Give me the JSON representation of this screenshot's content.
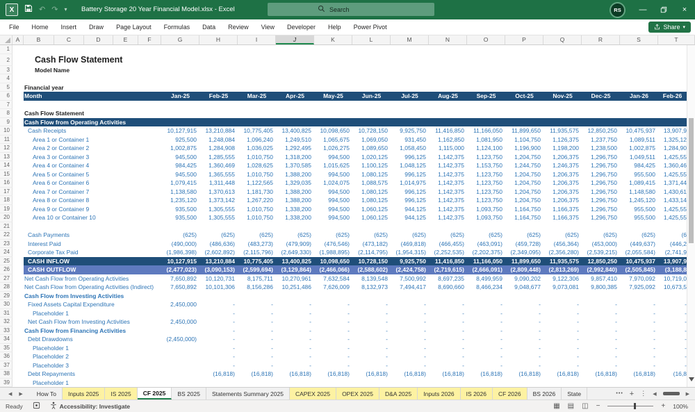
{
  "titlebar": {
    "title": "Battery Storage 20 Year Financial Model.xlsx - Excel",
    "search_placeholder": "Search",
    "avatar_initials": "RS"
  },
  "menubar": {
    "tabs": [
      "File",
      "Home",
      "Insert",
      "Draw",
      "Page Layout",
      "Formulas",
      "Data",
      "Review",
      "View",
      "Developer",
      "Help",
      "Power Pivot"
    ],
    "share_label": "Share"
  },
  "columns": {
    "letters": [
      "A",
      "B",
      "C",
      "D",
      "E",
      "F",
      "G",
      "H",
      "I",
      "J",
      "K",
      "L",
      "M",
      "N",
      "O",
      "P",
      "Q",
      "R",
      "S",
      "T"
    ],
    "selected": "J"
  },
  "sheet": {
    "months": [
      "Jan-25",
      "Feb-25",
      "Mar-25",
      "Apr-25",
      "May-25",
      "Jun-25",
      "Jul-25",
      "Aug-25",
      "Sep-25",
      "Oct-25",
      "Nov-25",
      "Dec-25",
      "Jan-26",
      "Feb-26"
    ],
    "rows": [
      {
        "n": 1,
        "t": "blank"
      },
      {
        "n": 2,
        "t": "title",
        "ind": 3,
        "label": "Cash Flow Statement"
      },
      {
        "n": 3,
        "t": "bold",
        "ind": 3,
        "label": "Model Name"
      },
      {
        "n": 4,
        "t": "blank"
      },
      {
        "n": 5,
        "t": "bold",
        "ind": 0,
        "label": "Financial year"
      },
      {
        "n": 6,
        "t": "months",
        "ind": 0,
        "label": "Month"
      },
      {
        "n": 7,
        "t": "blank"
      },
      {
        "n": 8,
        "t": "bold",
        "ind": 0,
        "label": "Cash Flow Statement"
      },
      {
        "n": 9,
        "t": "banner",
        "ind": 0,
        "label": "Cash Flow from Operating Activities"
      },
      {
        "n": 10,
        "t": "item",
        "ind": 1,
        "label": "Cash Receipts",
        "v": [
          "10,127,915",
          "13,210,884",
          "10,775,405",
          "13,400,825",
          "10,098,650",
          "10,728,150",
          "9,925,750",
          "11,416,850",
          "11,166,050",
          "11,899,650",
          "11,935,575",
          "12,850,250",
          "10,475,937",
          "13,907,9"
        ]
      },
      {
        "n": 11,
        "t": "item",
        "ind": 2,
        "label": "Area 1 or Container 1",
        "v": [
          "925,500",
          "1,248,084",
          "1,096,240",
          "1,249,510",
          "1,065,675",
          "1,069,050",
          "931,450",
          "1,162,850",
          "1,081,950",
          "1,104,750",
          "1,126,375",
          "1,237,750",
          "1,089,511",
          "1,325,12"
        ]
      },
      {
        "n": 12,
        "t": "item",
        "ind": 2,
        "label": "Area 2 or Container 2",
        "v": [
          "1,002,875",
          "1,284,908",
          "1,036,025",
          "1,292,495",
          "1,026,275",
          "1,089,650",
          "1,058,450",
          "1,115,000",
          "1,124,100",
          "1,196,900",
          "1,198,200",
          "1,238,500",
          "1,002,875",
          "1,284,90"
        ]
      },
      {
        "n": 13,
        "t": "item",
        "ind": 2,
        "label": "Area 3 or Container 3",
        "v": [
          "945,500",
          "1,285,555",
          "1,010,750",
          "1,318,200",
          "994,500",
          "1,020,125",
          "996,125",
          "1,142,375",
          "1,123,750",
          "1,204,750",
          "1,206,375",
          "1,296,750",
          "1,049,511",
          "1,425,55"
        ]
      },
      {
        "n": 14,
        "t": "item",
        "ind": 2,
        "label": "Area 4 or Container 4",
        "v": [
          "984,425",
          "1,360,469",
          "1,028,625",
          "1,370,585",
          "1,015,625",
          "1,100,125",
          "1,048,125",
          "1,142,375",
          "1,153,750",
          "1,244,750",
          "1,246,375",
          "1,296,750",
          "984,425",
          "1,360,46"
        ]
      },
      {
        "n": 15,
        "t": "item",
        "ind": 2,
        "label": "Area 5 or Container 5",
        "v": [
          "945,500",
          "1,365,555",
          "1,010,750",
          "1,388,200",
          "994,500",
          "1,080,125",
          "996,125",
          "1,142,375",
          "1,123,750",
          "1,204,750",
          "1,206,375",
          "1,296,750",
          "955,500",
          "1,425,55"
        ]
      },
      {
        "n": 16,
        "t": "item",
        "ind": 2,
        "label": "Area 6 or Container 6",
        "v": [
          "1,079,415",
          "1,311,448",
          "1,122,565",
          "1,329,035",
          "1,024,075",
          "1,088,575",
          "1,014,975",
          "1,142,375",
          "1,123,750",
          "1,204,750",
          "1,206,375",
          "1,296,750",
          "1,089,415",
          "1,371,44"
        ]
      },
      {
        "n": 17,
        "t": "item",
        "ind": 2,
        "label": "Area 7 or Container 7",
        "v": [
          "1,138,580",
          "1,370,613",
          "1,181,730",
          "1,388,200",
          "994,500",
          "1,080,125",
          "996,125",
          "1,142,375",
          "1,123,750",
          "1,204,750",
          "1,206,375",
          "1,296,750",
          "1,148,580",
          "1,430,61"
        ]
      },
      {
        "n": 18,
        "t": "item",
        "ind": 2,
        "label": "Area 8 or Container 8",
        "v": [
          "1,235,120",
          "1,373,142",
          "1,267,220",
          "1,388,200",
          "994,500",
          "1,080,125",
          "996,125",
          "1,142,375",
          "1,123,750",
          "1,204,750",
          "1,206,375",
          "1,296,750",
          "1,245,120",
          "1,433,14"
        ]
      },
      {
        "n": 19,
        "t": "item",
        "ind": 2,
        "label": "Area 9 or Container 9",
        "v": [
          "935,500",
          "1,305,555",
          "1,010,750",
          "1,338,200",
          "994,500",
          "1,060,125",
          "944,125",
          "1,142,375",
          "1,093,750",
          "1,164,750",
          "1,166,375",
          "1,296,750",
          "955,500",
          "1,425,55"
        ]
      },
      {
        "n": 20,
        "t": "item",
        "ind": 2,
        "label": "Area 10 or Container 10",
        "v": [
          "935,500",
          "1,305,555",
          "1,010,750",
          "1,338,200",
          "994,500",
          "1,060,125",
          "944,125",
          "1,142,375",
          "1,093,750",
          "1,164,750",
          "1,166,375",
          "1,296,750",
          "955,500",
          "1,425,55"
        ]
      },
      {
        "n": 21,
        "t": "blank"
      },
      {
        "n": 22,
        "t": "item",
        "ind": 1,
        "label": "Cash Payments",
        "v": [
          "(625)",
          "(625)",
          "(625)",
          "(625)",
          "(625)",
          "(625)",
          "(625)",
          "(625)",
          "(625)",
          "(625)",
          "(625)",
          "(625)",
          "(625)",
          "(6"
        ]
      },
      {
        "n": 23,
        "t": "item",
        "ind": 1,
        "label": "Interest Paid",
        "v": [
          "(490,000)",
          "(486,636)",
          "(483,273)",
          "(479,909)",
          "(476,546)",
          "(473,182)",
          "(469,818)",
          "(466,455)",
          "(463,091)",
          "(459,728)",
          "(456,364)",
          "(453,000)",
          "(449,637)",
          "(446,2"
        ]
      },
      {
        "n": 24,
        "t": "item",
        "ind": 1,
        "label": "Corporate Tax Paid",
        "v": [
          "(1,986,398)",
          "(2,602,892)",
          "(2,115,796)",
          "(2,649,330)",
          "(1,988,895)",
          "(2,114,795)",
          "(1,954,315)",
          "(2,252,535)",
          "(2,202,375)",
          "(2,349,095)",
          "(2,356,280)",
          "(2,539,215)",
          "(2,055,584)",
          "(2,741,9"
        ]
      },
      {
        "n": 25,
        "t": "total-dark",
        "ind": 1,
        "label": "CASH INFLOW",
        "v": [
          "10,127,915",
          "13,210,884",
          "10,775,405",
          "13,400,825",
          "10,098,650",
          "10,728,150",
          "9,925,750",
          "11,416,850",
          "11,166,050",
          "11,899,650",
          "11,935,575",
          "12,850,250",
          "10,475,937",
          "13,907,9"
        ]
      },
      {
        "n": 26,
        "t": "total-mid",
        "ind": 1,
        "label": "CASH OUTFLOW",
        "v": [
          "(2,477,023)",
          "(3,090,153)",
          "(2,599,694)",
          "(3,129,864)",
          "(2,466,066)",
          "(2,588,602)",
          "(2,424,758)",
          "(2,719,615)",
          "(2,666,091)",
          "(2,809,448)",
          "(2,813,269)",
          "(2,992,840)",
          "(2,505,845)",
          "(3,188,8"
        ]
      },
      {
        "n": 27,
        "t": "item",
        "ind": 0,
        "label": "Net Cash Flow from Operating Activities",
        "v": [
          "7,650,892",
          "10,120,731",
          "8,175,711",
          "10,270,961",
          "7,632,584",
          "8,139,548",
          "7,500,992",
          "8,697,235",
          "8,499,959",
          "9,090,202",
          "9,122,306",
          "9,857,410",
          "7,970,092",
          "10,719,0"
        ]
      },
      {
        "n": 28,
        "t": "item",
        "ind": 0,
        "label": "Net Cash Flow from Operating Activities (Indirect)",
        "v": [
          "7,650,892",
          "10,101,306",
          "8,156,286",
          "10,251,486",
          "7,626,009",
          "8,132,973",
          "7,494,417",
          "8,690,660",
          "8,466,234",
          "9,048,677",
          "9,073,081",
          "9,800,385",
          "7,925,092",
          "10,673,5"
        ]
      },
      {
        "n": 29,
        "t": "section",
        "ind": 0,
        "label": "Cash Flow from Investing Activities"
      },
      {
        "n": 30,
        "t": "item",
        "ind": 1,
        "label": "Fixed Assets Capital Expenditure",
        "v": [
          "2,450,000",
          "-",
          "-",
          "-",
          "-",
          "-",
          "-",
          "-",
          "-",
          "-",
          "-",
          "-",
          "-",
          "-"
        ]
      },
      {
        "n": 31,
        "t": "item",
        "ind": 2,
        "label": "Placeholder 1",
        "v": [
          "",
          "-",
          "-",
          "-",
          "-",
          "-",
          "-",
          "-",
          "-",
          "-",
          "-",
          "-",
          "-",
          "-"
        ]
      },
      {
        "n": 32,
        "t": "item",
        "ind": 1,
        "label": "Net Cash Flow from Investing Activities",
        "v": [
          "2,450,000",
          "-",
          "-",
          "-",
          "-",
          "-",
          "-",
          "-",
          "-",
          "-",
          "-",
          "-",
          "-",
          "-"
        ]
      },
      {
        "n": 33,
        "t": "section",
        "ind": 0,
        "label": "Cash Flow from Financing Activities",
        "v": [
          "",
          "-",
          "-",
          "-",
          "-",
          "-",
          "-",
          "-",
          "-",
          "-",
          "-",
          "-",
          "-",
          "-"
        ]
      },
      {
        "n": 34,
        "t": "item",
        "ind": 1,
        "label": "Debt Drawdowns",
        "v": [
          "(2,450,000)",
          "-",
          "-",
          "-",
          "-",
          "-",
          "-",
          "-",
          "-",
          "-",
          "-",
          "-",
          "-",
          "-"
        ]
      },
      {
        "n": 35,
        "t": "item",
        "ind": 2,
        "label": "Placeholder 1",
        "v": [
          "",
          "-",
          "-",
          "-",
          "-",
          "-",
          "-",
          "-",
          "-",
          "-",
          "-",
          "-",
          "-",
          "-"
        ]
      },
      {
        "n": 36,
        "t": "item",
        "ind": 2,
        "label": "Placeholder 2",
        "v": [
          "",
          "-",
          "-",
          "-",
          "-",
          "-",
          "-",
          "-",
          "-",
          "-",
          "-",
          "-",
          "-",
          "-"
        ]
      },
      {
        "n": 37,
        "t": "item",
        "ind": 2,
        "label": "Placeholder 3",
        "v": [
          "",
          "-",
          "-",
          "-",
          "-",
          "-",
          "-",
          "-",
          "-",
          "-",
          "-",
          "-",
          "-",
          "-"
        ]
      },
      {
        "n": 38,
        "t": "item",
        "ind": 1,
        "label": "Debt Repayments",
        "v": [
          "",
          "(16,818)",
          "(16,818)",
          "(16,818)",
          "(16,818)",
          "(16,818)",
          "(16,818)",
          "(16,818)",
          "(16,818)",
          "(16,818)",
          "(16,818)",
          "(16,818)",
          "(16,818)",
          "(16,8"
        ]
      },
      {
        "n": 39,
        "t": "item",
        "ind": 2,
        "label": "Placeholder 1"
      }
    ]
  },
  "tabs": {
    "items": [
      {
        "label": "How To",
        "style": "plain"
      },
      {
        "label": "Inputs 2025",
        "style": "yellow"
      },
      {
        "label": "IS 2025",
        "style": "yellow"
      },
      {
        "label": "CF 2025",
        "style": "active"
      },
      {
        "label": "BS 2025",
        "style": "plain"
      },
      {
        "label": "Statements Summary 2025",
        "style": "plain"
      },
      {
        "label": "CAPEX 2025",
        "style": "yellow"
      },
      {
        "label": "OPEX 2025",
        "style": "yellow"
      },
      {
        "label": "D&A 2025",
        "style": "yellow"
      },
      {
        "label": "Inputs 2026",
        "style": "yellow"
      },
      {
        "label": "IS 2026",
        "style": "yellow"
      },
      {
        "label": "CF 2026",
        "style": "yellow"
      },
      {
        "label": "BS 2026",
        "style": "plain"
      },
      {
        "label": "State",
        "style": "plain"
      }
    ],
    "more_label": "•••",
    "add_label": "+",
    "split_label": "⋮"
  },
  "statusbar": {
    "ready_label": "Ready",
    "accessibility_label": "Accessibility: Investigate",
    "zoom_label": "100%"
  },
  "colors": {
    "titlebar_green": "#1E7145",
    "ribbon_green": "#217346",
    "banner_dark_blue": "#1F4E79",
    "banner_mid_blue": "#5E7ABF",
    "accent_blue": "#2E75B6",
    "tab_yellow": "#FDF2A2"
  }
}
